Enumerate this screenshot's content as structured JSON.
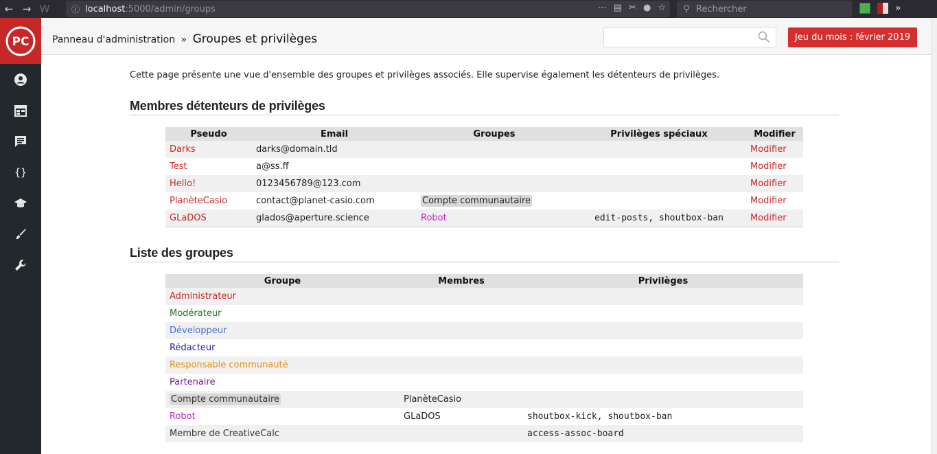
{
  "browser": {
    "url_host": "localhost",
    "url_path": ":5000/admin/groups",
    "search_placeholder": "Rechercher"
  },
  "header": {
    "breadcrumb_root": "Panneau d'administration",
    "breadcrumb_sep": "»",
    "breadcrumb_current": "Groupes et privilèges",
    "search_placeholder": "",
    "game_button": "Jeu du mois : février 2019"
  },
  "sidebar": {
    "icons": [
      "user-icon",
      "calendar-icon",
      "forum-icon",
      "code-braces-icon",
      "school-icon",
      "brush-icon",
      "wrench-icon"
    ]
  },
  "intro": "Cette page présente une vue d'ensemble des groupes et privilèges associés. Elle supervise également les détenteurs de privilèges.",
  "members": {
    "title": "Membres détenteurs de privilèges",
    "headers": [
      "Pseudo",
      "Email",
      "Groupes",
      "Privilèges spéciaux",
      "Modifier"
    ],
    "rows": [
      {
        "pseudo": "Darks",
        "email": "darks@domain.tld",
        "groups": "",
        "privs": "",
        "modify": "Modifier"
      },
      {
        "pseudo": "Test",
        "email": "a@ss.ff",
        "groups": "",
        "privs": "",
        "modify": "Modifier"
      },
      {
        "pseudo": "Hello!",
        "email": "0123456789@123.com",
        "groups": "",
        "privs": "",
        "modify": "Modifier"
      },
      {
        "pseudo": "PlanèteCasio",
        "email": "contact@planet-casio.com",
        "groups": "Compte communautaire",
        "privs": "",
        "modify": "Modifier"
      },
      {
        "pseudo": "GLaDOS",
        "email": "glados@aperture.science",
        "groups": "Robot",
        "privs": "edit-posts, shoutbox-ban",
        "modify": "Modifier"
      }
    ]
  },
  "groups": {
    "title": "Liste des groupes",
    "headers": [
      "Groupe",
      "Membres",
      "Privilèges"
    ],
    "rows": [
      {
        "name": "Administrateur",
        "members": "",
        "privs": "",
        "color": "#c62828"
      },
      {
        "name": "Modérateur",
        "members": "",
        "privs": "",
        "color": "#1b7a1b"
      },
      {
        "name": "Développeur",
        "members": "",
        "privs": "",
        "color": "#4a6fd6"
      },
      {
        "name": "Rédacteur",
        "members": "",
        "privs": "",
        "color": "#1a1ab0"
      },
      {
        "name": "Responsable communauté",
        "members": "",
        "privs": "",
        "color": "#e8900c"
      },
      {
        "name": "Partenaire",
        "members": "",
        "privs": "",
        "color": "#7a1a9a"
      },
      {
        "name": "Compte communautaire",
        "members": "PlanèteCasio",
        "privs": "",
        "color": "#333333"
      },
      {
        "name": "Robot",
        "members": "GLaDOS",
        "privs": "shoutbox-kick, shoutbox-ban",
        "color": "#c028c0"
      },
      {
        "name": "Membre de CreativeCalc",
        "members": "",
        "privs": "access-assoc-board",
        "color": "#333333"
      }
    ]
  }
}
